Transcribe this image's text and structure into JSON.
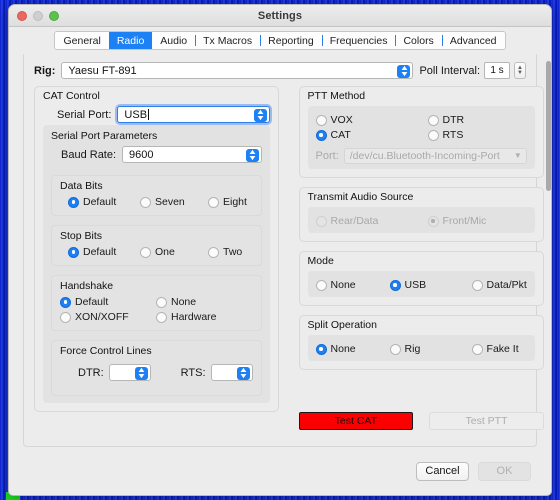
{
  "window": {
    "title": "Settings",
    "traffic_lights": [
      "close",
      "minimize",
      "zoom"
    ]
  },
  "tabs": [
    {
      "label": "General",
      "active": false
    },
    {
      "label": "Radio",
      "active": true
    },
    {
      "label": "Audio",
      "active": false
    },
    {
      "label": "Tx Macros",
      "active": false
    },
    {
      "label": "Reporting",
      "active": false
    },
    {
      "label": "Frequencies",
      "active": false
    },
    {
      "label": "Colors",
      "active": false
    },
    {
      "label": "Advanced",
      "active": false
    }
  ],
  "rig": {
    "label": "Rig:",
    "value": "Yaesu FT-891"
  },
  "poll": {
    "label": "Poll Interval:",
    "value": "1 s"
  },
  "cat_control": {
    "title": "CAT Control",
    "serial_port": {
      "label": "Serial Port:",
      "value": "USB"
    },
    "parameters_title": "Serial Port Parameters",
    "baud_rate": {
      "label": "Baud Rate:",
      "value": "9600"
    },
    "data_bits": {
      "title": "Data Bits",
      "options": [
        {
          "label": "Default",
          "selected": true
        },
        {
          "label": "Seven",
          "selected": false
        },
        {
          "label": "Eight",
          "selected": false
        }
      ]
    },
    "stop_bits": {
      "title": "Stop Bits",
      "options": [
        {
          "label": "Default",
          "selected": true
        },
        {
          "label": "One",
          "selected": false
        },
        {
          "label": "Two",
          "selected": false
        }
      ]
    },
    "handshake": {
      "title": "Handshake",
      "options": [
        {
          "label": "Default",
          "selected": true
        },
        {
          "label": "None",
          "selected": false
        },
        {
          "label": "XON/XOFF",
          "selected": false
        },
        {
          "label": "Hardware",
          "selected": false
        }
      ]
    },
    "force_control_lines": {
      "title": "Force Control Lines",
      "dtr": {
        "label": "DTR:",
        "value": ""
      },
      "rts": {
        "label": "RTS:",
        "value": ""
      }
    }
  },
  "ptt_method": {
    "title": "PTT Method",
    "options": [
      {
        "label": "VOX",
        "selected": false,
        "disabled": false
      },
      {
        "label": "DTR",
        "selected": false,
        "disabled": false
      },
      {
        "label": "CAT",
        "selected": true,
        "disabled": false
      },
      {
        "label": "RTS",
        "selected": false,
        "disabled": false
      }
    ],
    "port": {
      "label": "Port:",
      "value": "/dev/cu.Bluetooth-Incoming-Port",
      "disabled": true
    }
  },
  "transmit_audio_source": {
    "title": "Transmit Audio Source",
    "options": [
      {
        "label": "Rear/Data",
        "selected": false,
        "disabled": true
      },
      {
        "label": "Front/Mic",
        "selected": true,
        "disabled": true
      }
    ]
  },
  "mode": {
    "title": "Mode",
    "options": [
      {
        "label": "None",
        "selected": false
      },
      {
        "label": "USB",
        "selected": true
      },
      {
        "label": "Data/Pkt",
        "selected": false
      }
    ]
  },
  "split_operation": {
    "title": "Split Operation",
    "options": [
      {
        "label": "None",
        "selected": true
      },
      {
        "label": "Rig",
        "selected": false
      },
      {
        "label": "Fake It",
        "selected": false
      }
    ]
  },
  "test_buttons": {
    "test_cat": {
      "label": "Test CAT",
      "state_color": "#fb0000",
      "enabled": true
    },
    "test_ptt": {
      "label": "Test PTT",
      "enabled": false
    }
  },
  "footer": {
    "cancel": "Cancel",
    "ok": "OK"
  },
  "colors": {
    "accent": "#1b81f5",
    "danger": "#fb0000",
    "window_bg": "#ececec",
    "group_bg": "#e2e2e2"
  }
}
